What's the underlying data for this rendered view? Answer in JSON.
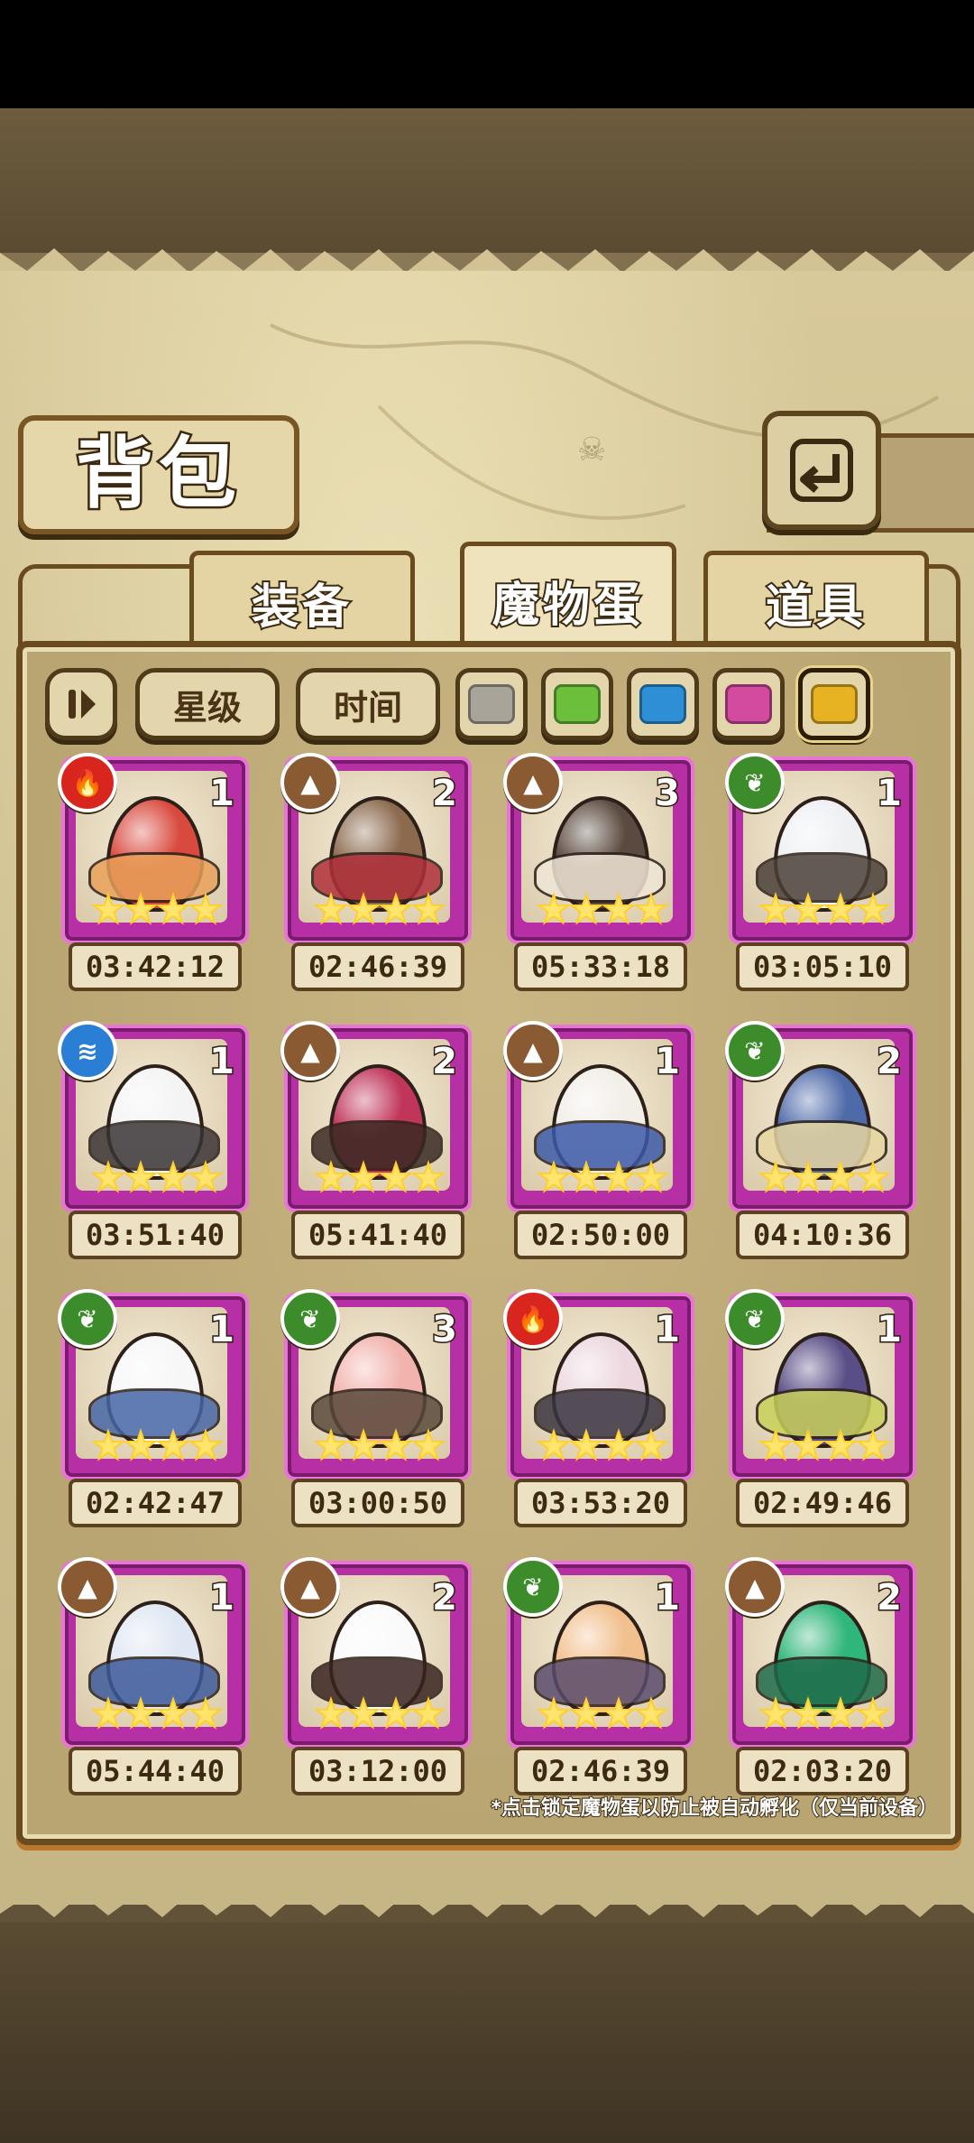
{
  "title": "背包",
  "tabs": [
    {
      "label": "装备",
      "active": false
    },
    {
      "label": "魔物蛋",
      "active": true
    },
    {
      "label": "道具",
      "active": false
    }
  ],
  "filters": {
    "sort_icon": "sort-toggle-icon",
    "star_label": "星级",
    "time_label": "时间",
    "colors": [
      {
        "name": "gray",
        "hex": "#a8a49a"
      },
      {
        "name": "green",
        "hex": "#6bbf3a"
      },
      {
        "name": "blue",
        "hex": "#2f8fd6"
      },
      {
        "name": "pink",
        "hex": "#d24b9f"
      },
      {
        "name": "gold",
        "hex": "#e8b323",
        "selected": true
      }
    ]
  },
  "element_colors": {
    "fire": "#d8261e",
    "earth": "#8a5a33",
    "nature": "#3d8c2b",
    "water": "#2a7fd4"
  },
  "eggs": [
    {
      "element": "fire",
      "count": "1",
      "stars": 4,
      "time": "03:42:12",
      "egg_color": "#d94a3e",
      "deco_color": "#e9a15b"
    },
    {
      "element": "earth",
      "count": "2",
      "stars": 4,
      "time": "02:46:39",
      "egg_color": "#8b6a4e",
      "deco_color": "#b0303a"
    },
    {
      "element": "earth",
      "count": "3",
      "stars": 4,
      "time": "05:33:18",
      "egg_color": "#5b4a3f",
      "deco_color": "#efe6d6"
    },
    {
      "element": "nature",
      "count": "1",
      "stars": 4,
      "time": "03:05:10",
      "egg_color": "#eef0f2",
      "deco_color": "#4b4038"
    },
    {
      "element": "water",
      "count": "1",
      "stars": 4,
      "time": "03:51:40",
      "egg_color": "#f4f4f4",
      "deco_color": "#3a3436"
    },
    {
      "element": "earth",
      "count": "2",
      "stars": 4,
      "time": "05:41:40",
      "egg_color": "#c0355a",
      "deco_color": "#3a2a24"
    },
    {
      "element": "earth",
      "count": "1",
      "stars": 4,
      "time": "02:50:00",
      "egg_color": "#f2eee8",
      "deco_color": "#3c5aa8"
    },
    {
      "element": "nature",
      "count": "2",
      "stars": 4,
      "time": "04:10:36",
      "egg_color": "#4e6aa9",
      "deco_color": "#e8d7a2"
    },
    {
      "element": "nature",
      "count": "1",
      "stars": 4,
      "time": "02:42:47",
      "egg_color": "#f7f7f7",
      "deco_color": "#4767a6"
    },
    {
      "element": "nature",
      "count": "3",
      "stars": 4,
      "time": "03:00:50",
      "egg_color": "#f2b3ae",
      "deco_color": "#5a4a3c"
    },
    {
      "element": "fire",
      "count": "1",
      "stars": 4,
      "time": "03:53:20",
      "egg_color": "#ecd8de",
      "deco_color": "#3a3440"
    },
    {
      "element": "nature",
      "count": "1",
      "stars": 4,
      "time": "02:49:46",
      "egg_color": "#5a4e86",
      "deco_color": "#c8d15a"
    },
    {
      "element": "earth",
      "count": "1",
      "stars": 4,
      "time": "05:44:40",
      "egg_color": "#dfe7f3",
      "deco_color": "#3d5a9b"
    },
    {
      "element": "earth",
      "count": "2",
      "stars": 4,
      "time": "03:12:00",
      "egg_color": "#fafafa",
      "deco_color": "#3a2420"
    },
    {
      "element": "nature",
      "count": "1",
      "stars": 4,
      "time": "02:46:39",
      "egg_color": "#f2c08e",
      "deco_color": "#5a4c6e"
    },
    {
      "element": "earth",
      "count": "2",
      "stars": 4,
      "time": "02:03:20",
      "egg_color": "#2fb67a",
      "deco_color": "#1f6b4a"
    }
  ],
  "note": "*点击锁定魔物蛋以防止被自动孵化（仅当前设备）"
}
